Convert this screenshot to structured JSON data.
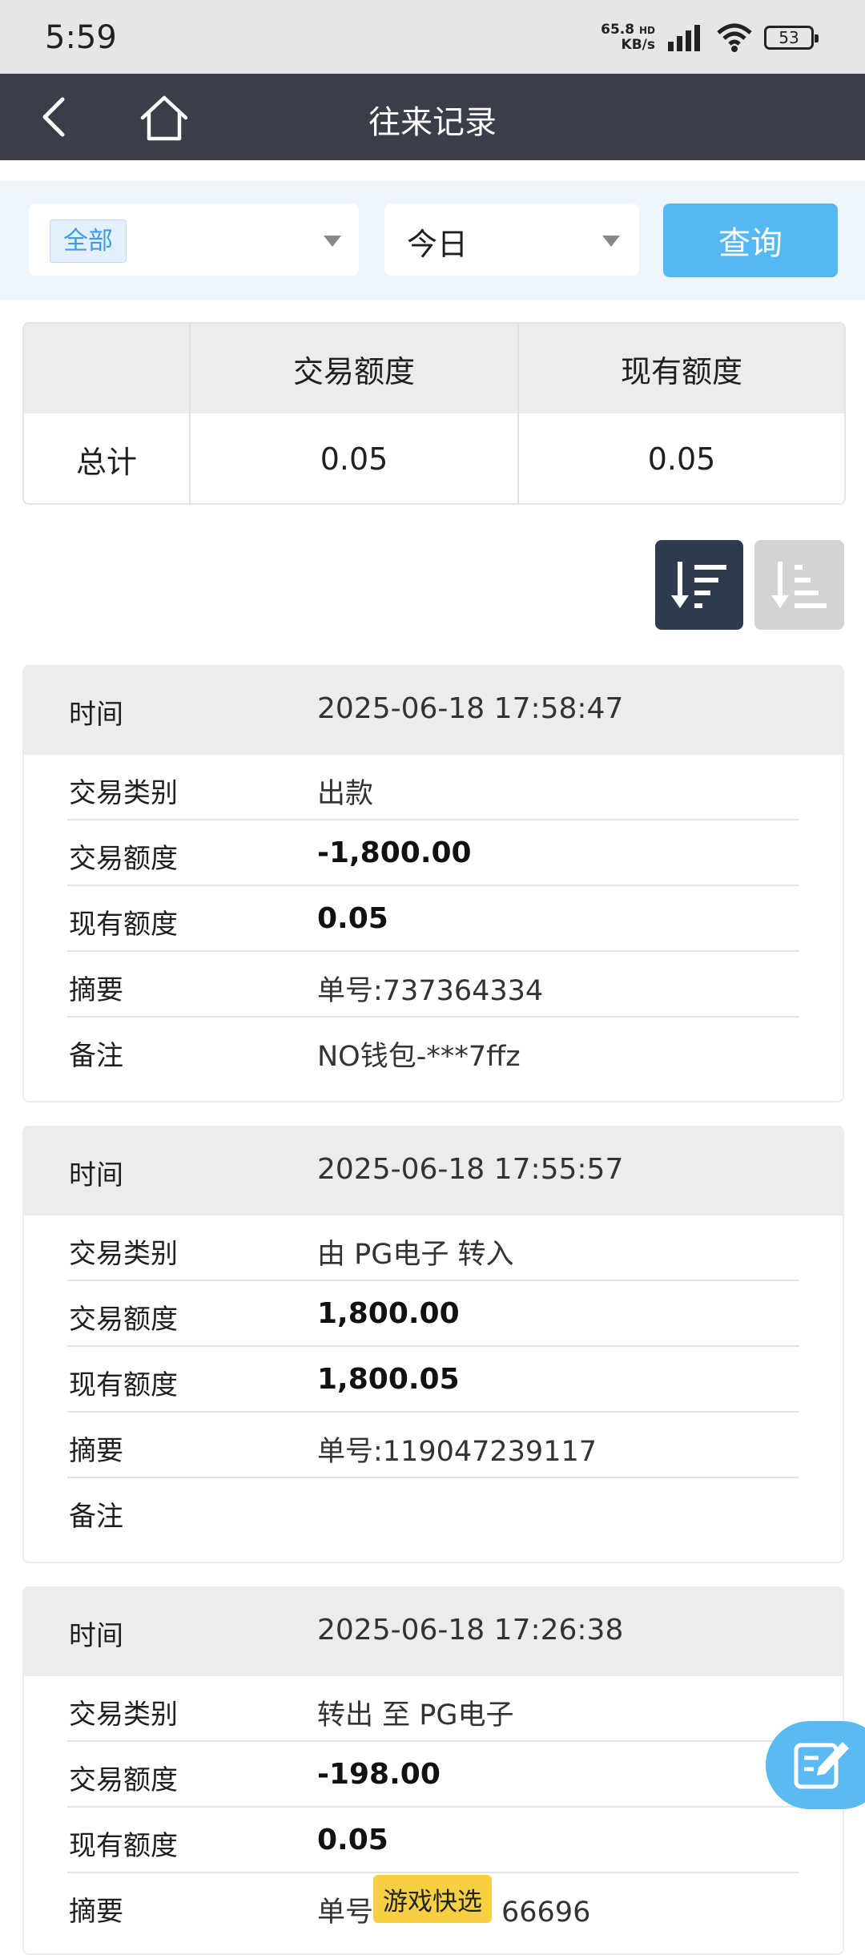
{
  "status_bar": {
    "time": "5:59",
    "net_speed_value": "65.8",
    "net_speed_unit": "KB/s",
    "net_hd": "HD",
    "battery": "53"
  },
  "nav": {
    "title": "往来记录",
    "back_icon": "chevron-left-icon",
    "home_icon": "home-icon"
  },
  "filters": {
    "type_tag": "全部",
    "period": "今日",
    "query_label": "查询"
  },
  "summary": {
    "headers": [
      "",
      "交易额度",
      "现有额度"
    ],
    "row_label": "总计",
    "trade_amount": "0.05",
    "current_amount": "0.05"
  },
  "sort": {
    "desc_icon": "sort-descending-icon",
    "asc_icon": "sort-ascending-icon"
  },
  "labels": {
    "time": "时间",
    "type": "交易类别",
    "amount": "交易额度",
    "balance": "现有额度",
    "summary": "摘要",
    "note": "备注"
  },
  "records": [
    {
      "time": "2025-06-18 17:58:47",
      "type": "出款",
      "amount": "-1,800.00",
      "balance": "0.05",
      "summary": "单号:737364334",
      "note": "NO钱包-***7ffz"
    },
    {
      "time": "2025-06-18 17:55:57",
      "type": "由 PG电子 转入",
      "amount": "1,800.00",
      "balance": "1,800.05",
      "summary": "单号:119047239117",
      "note": ""
    },
    {
      "time": "2025-06-18 17:26:38",
      "type": "转出 至 PG电子",
      "amount": "-198.00",
      "balance": "0.05",
      "summary": "单号",
      "summary_tail": "66696"
    }
  ],
  "floating": {
    "game_shortcut": "游戏快选",
    "edit_icon": "edit-icon"
  },
  "colors": {
    "nav_bg": "#3b3e48",
    "accent": "#55b8f3",
    "sort_active": "#2e3a4e"
  }
}
